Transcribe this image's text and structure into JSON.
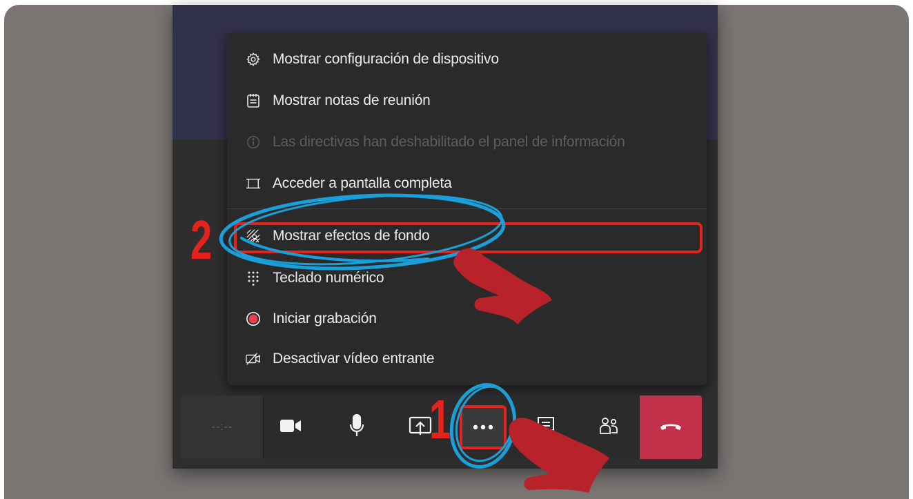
{
  "menu": {
    "items": [
      {
        "label": "Mostrar configuración de dispositivo",
        "icon": "gear-icon",
        "disabled": false
      },
      {
        "label": "Mostrar notas de reunión",
        "icon": "notes-icon",
        "disabled": false
      },
      {
        "label": "Las directivas han deshabilitado el panel de información",
        "icon": "info-icon",
        "disabled": true
      },
      {
        "label": "Acceder a pantalla completa",
        "icon": "fullscreen-icon",
        "disabled": false
      },
      {
        "label": "Mostrar efectos de fondo",
        "icon": "background-effects-icon",
        "disabled": false
      },
      {
        "label": "Teclado numérico",
        "icon": "dialpad-icon",
        "disabled": false
      },
      {
        "label": "Iniciar grabación",
        "icon": "record-icon",
        "disabled": false
      },
      {
        "label": "Desactivar vídeo entrante",
        "icon": "video-off-icon",
        "disabled": false
      }
    ]
  },
  "toolbar": {
    "timer": "--:--",
    "buttons": [
      "camera-icon",
      "microphone-icon",
      "share-screen-icon",
      "more-options-icon",
      "chat-icon",
      "participants-icon",
      "hang-up-icon"
    ]
  },
  "annotations": {
    "step1": "1",
    "step2": "2"
  },
  "colors": {
    "highlight": "#e3231c",
    "circle": "#19a0da",
    "hand": "#b8222a",
    "hangup": "#c4314b",
    "record": "#e8414c"
  }
}
